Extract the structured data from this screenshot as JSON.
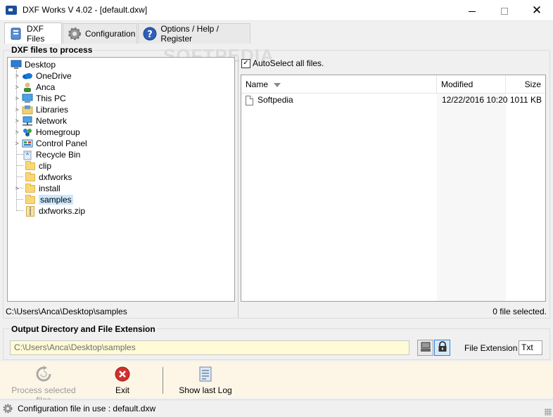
{
  "window": {
    "title": "DXF Works V 4.02 - [default.dxw]"
  },
  "tabs": [
    {
      "label": "DXF Files",
      "icon": "dxf-files-icon"
    },
    {
      "label": "Configuration",
      "icon": "gear-icon"
    },
    {
      "label": "Options / Help / Register",
      "icon": "help-icon"
    }
  ],
  "watermark": "SOFTPEDIA",
  "dxf_section": {
    "title": "DXF files to process",
    "tree": [
      {
        "label": "Desktop",
        "icon": "desktop-icon",
        "expandable": false
      },
      {
        "label": "OneDrive",
        "icon": "onedrive-icon",
        "expandable": true
      },
      {
        "label": "Anca",
        "icon": "user-icon",
        "expandable": true
      },
      {
        "label": "This PC",
        "icon": "computer-icon",
        "expandable": true
      },
      {
        "label": "Libraries",
        "icon": "libraries-icon",
        "expandable": true
      },
      {
        "label": "Network",
        "icon": "network-icon",
        "expandable": true
      },
      {
        "label": "Homegroup",
        "icon": "homegroup-icon",
        "expandable": true
      },
      {
        "label": "Control Panel",
        "icon": "control-panel-icon",
        "expandable": true
      },
      {
        "label": "Recycle Bin",
        "icon": "recycle-bin-icon",
        "expandable": false
      },
      {
        "label": "clip",
        "icon": "folder-icon",
        "expandable": false
      },
      {
        "label": "dxfworks",
        "icon": "folder-icon",
        "expandable": false
      },
      {
        "label": "install",
        "icon": "folder-icon",
        "expandable": true
      },
      {
        "label": "samples",
        "icon": "folder-icon",
        "expandable": false,
        "selected": true
      },
      {
        "label": "dxfworks.zip",
        "icon": "zip-icon",
        "expandable": false
      }
    ],
    "current_path": "C:\\Users\\Anca\\Desktop\\samples",
    "autoselect_label": "AutoSelect all files.",
    "autoselect_checked": true,
    "columns": {
      "name": "Name",
      "modified": "Modified",
      "size": "Size"
    },
    "files": [
      {
        "name": "Softpedia",
        "modified": "12/22/2016 10:20",
        "size": "1011 KB"
      }
    ],
    "selected_count": "0 file selected."
  },
  "output_section": {
    "title": "Output Directory and File Extension",
    "directory": "C:\\Users\\Anca\\Desktop\\samples",
    "extension_label": "File Extension :",
    "extension": "Txt"
  },
  "toolbar": {
    "process_label": "Process selected files",
    "exit_label": "Exit",
    "log_label": "Show last Log"
  },
  "status": {
    "text": "Configuration file in use : default.dxw"
  }
}
